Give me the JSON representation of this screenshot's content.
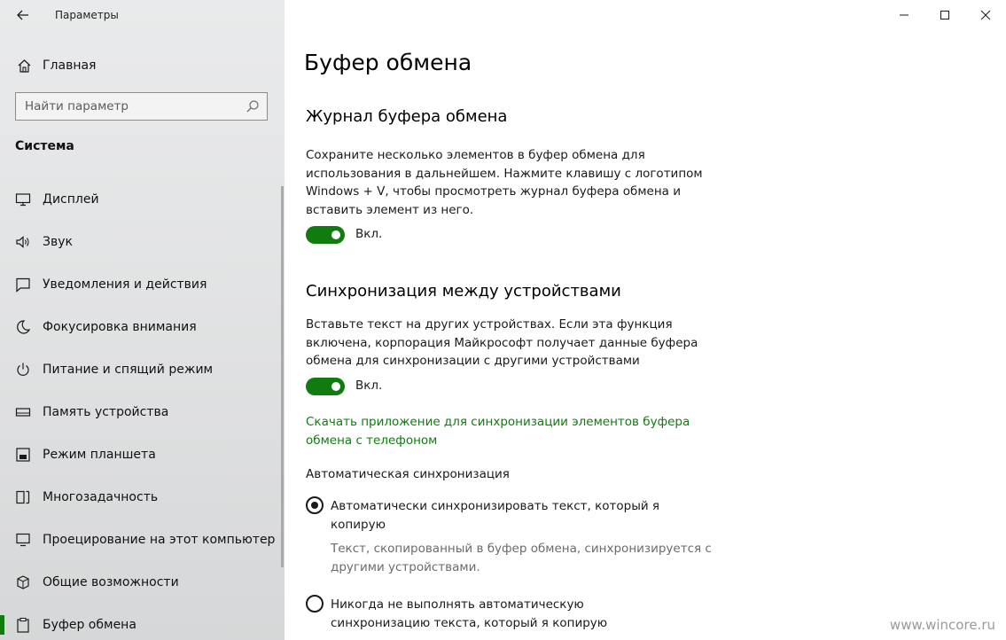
{
  "window": {
    "app_title": "Параметры",
    "controls": {
      "minimize_icon": "minimize-icon",
      "maximize_icon": "maximize-icon",
      "close_icon": "close-icon"
    }
  },
  "sidebar": {
    "home_label": "Главная",
    "search_placeholder": "Найти параметр",
    "section_title": "Система",
    "items": [
      {
        "label": "Дисплей",
        "icon": "monitor-icon"
      },
      {
        "label": "Звук",
        "icon": "speaker-icon"
      },
      {
        "label": "Уведомления и действия",
        "icon": "notification-icon"
      },
      {
        "label": "Фокусировка внимания",
        "icon": "moon-icon"
      },
      {
        "label": "Питание и спящий режим",
        "icon": "power-icon"
      },
      {
        "label": "Память устройства",
        "icon": "storage-icon"
      },
      {
        "label": "Режим планшета",
        "icon": "tablet-icon"
      },
      {
        "label": "Многозадачность",
        "icon": "multitasking-icon"
      },
      {
        "label": "Проецирование на этот компьютер",
        "icon": "projection-icon"
      },
      {
        "label": "Общие возможности",
        "icon": "shared-experiences-icon"
      },
      {
        "label": "Буфер обмена",
        "icon": "clipboard-icon",
        "selected": true
      }
    ]
  },
  "main": {
    "page_title": "Буфер обмена",
    "history": {
      "heading": "Журнал буфера обмена",
      "description": "Сохраните несколько элементов в буфер обмена для использования в дальнейшем. Нажмите клавишу с логотипом Windows + V, чтобы просмотреть журнал буфера обмена и вставить элемент из него.",
      "toggle_state": "on",
      "toggle_label": "Вкл."
    },
    "sync": {
      "heading": "Синхронизация между устройствами",
      "description": "Вставьте текст на других устройствах. Если эта функция включена, корпорация Майкрософт получает данные буфера обмена для синхронизации с другими устройствами",
      "toggle_state": "on",
      "toggle_label": "Вкл.",
      "link": "Скачать приложение для синхронизации элементов буфера обмена с телефоном",
      "auto_sync_label": "Автоматическая синхронизация",
      "options": [
        {
          "label": "Автоматически синхронизировать текст, который я копирую",
          "description": "Текст, скопированный в буфер обмена, синхронизируется с другими устройствами.",
          "selected": true
        },
        {
          "label": "Никогда не выполнять автоматическую синхронизацию текста, который я копирую",
          "selected": false
        }
      ]
    }
  },
  "watermark": "www.wincore.ru",
  "colors": {
    "accent": "#107c10",
    "sidebar_bg": "#e6e6e6",
    "text": "#1a1a1a",
    "muted": "#6b6b6b"
  }
}
